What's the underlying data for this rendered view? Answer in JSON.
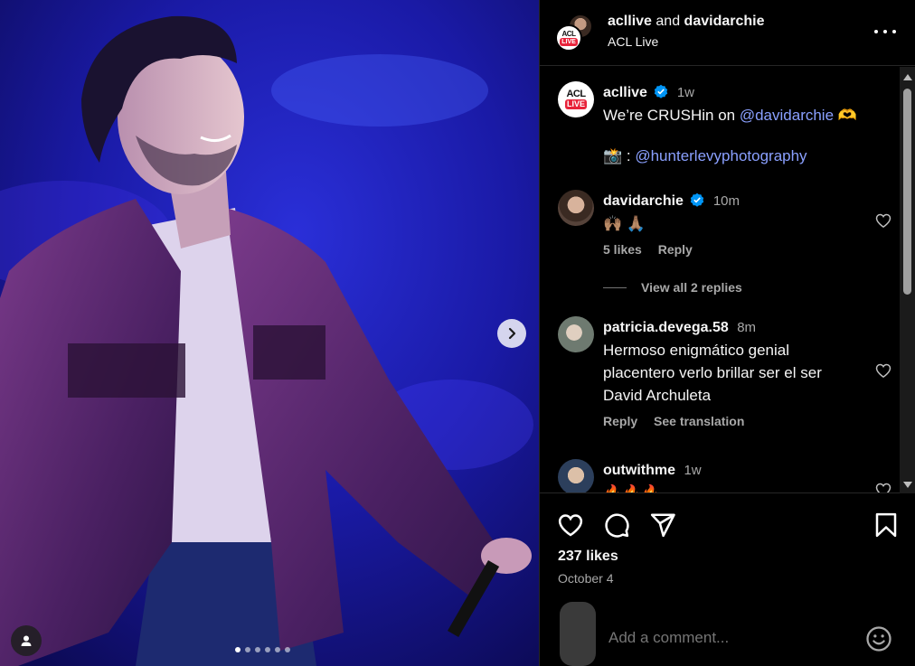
{
  "header": {
    "account1": "acllive",
    "and_text": "and",
    "account2": "davidarchie",
    "subtitle": "ACL Live",
    "logo_top": "ACL",
    "logo_bottom": "LIVE"
  },
  "caption": {
    "username": "acllive",
    "time": "1w",
    "text_prefix": "We’re CRUSHin on ",
    "mention": "@davidarchie",
    "emoji": "🫶",
    "credit_prefix": "📸 : ",
    "credit_mention": "@hunterlevyphotography"
  },
  "comments": [
    {
      "username": "davidarchie",
      "verified": true,
      "time": "10m",
      "text": "🙌🏽 🙏🏽",
      "likes": "5 likes",
      "reply": "Reply",
      "view_replies": "View all 2 replies"
    },
    {
      "username": "patricia.devega.58",
      "verified": false,
      "time": "8m",
      "text": "Hermoso enigmático genial placentero verlo brillar ser el ser David Archuleta",
      "reply": "Reply",
      "translation": "See translation"
    },
    {
      "username": "outwithme",
      "verified": false,
      "time": "1w",
      "text": "🔥🔥🔥"
    }
  ],
  "actions": {
    "likes": "237 likes",
    "date": "October 4"
  },
  "add_comment": {
    "placeholder": "Add a comment..."
  },
  "carousel": {
    "total": 6,
    "active": 0
  },
  "colors": {
    "background": "#000000",
    "link": "#8aa0ff",
    "muted": "#a8a8a8",
    "verified": "#0095f6",
    "acl_red": "#e8233a"
  },
  "icons": {
    "next": "chevron-right-icon",
    "user_tag": "user-icon",
    "more": "more-horizontal-icon",
    "like": "heart-icon",
    "comment": "comment-icon",
    "share": "send-icon",
    "save": "bookmark-icon",
    "emoji": "smiley-icon"
  }
}
